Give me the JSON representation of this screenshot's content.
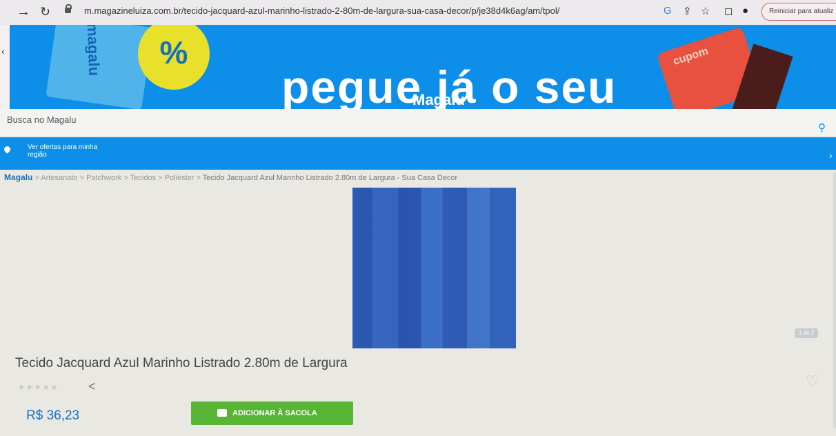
{
  "browser": {
    "url": "m.magazineluiza.com.br/tecido-jacquard-azul-marinho-listrado-2-80m-de-largura-sua-casa-decor/p/je38d4k6ag/am/tpol/",
    "restart_label": "Reiniciar para atualiz"
  },
  "banner": {
    "headline": "pegue já o seu",
    "brand": "Magalu",
    "coupon_left_text": "magalu",
    "percent_symbol": "%",
    "coupon_right_text": "cupom"
  },
  "search": {
    "placeholder": "Busca no Magalu"
  },
  "location": {
    "line1": "Ver ofertas para minha",
    "line2": "região"
  },
  "breadcrumb": {
    "logo": "Magalu",
    "items": [
      "Artesanato",
      "Patchwork",
      "Tecidos",
      "Poliéster"
    ],
    "current": "Tecido Jacquard Azul Marinho Listrado 2.80m de Largura - Sua Casa Decor",
    "separator": ">"
  },
  "gallery": {
    "counter": "1 de 2"
  },
  "product": {
    "title": "Tecido Jacquard Azul Marinho Listrado 2.80m de Largura",
    "price": "R$ 36,23",
    "add_button": "ADICIONAR À SACOLA",
    "rating_stars": 0
  },
  "colors": {
    "brand_blue": "#0d8ee8",
    "price_blue": "#1670c0",
    "add_green": "#57b435"
  }
}
